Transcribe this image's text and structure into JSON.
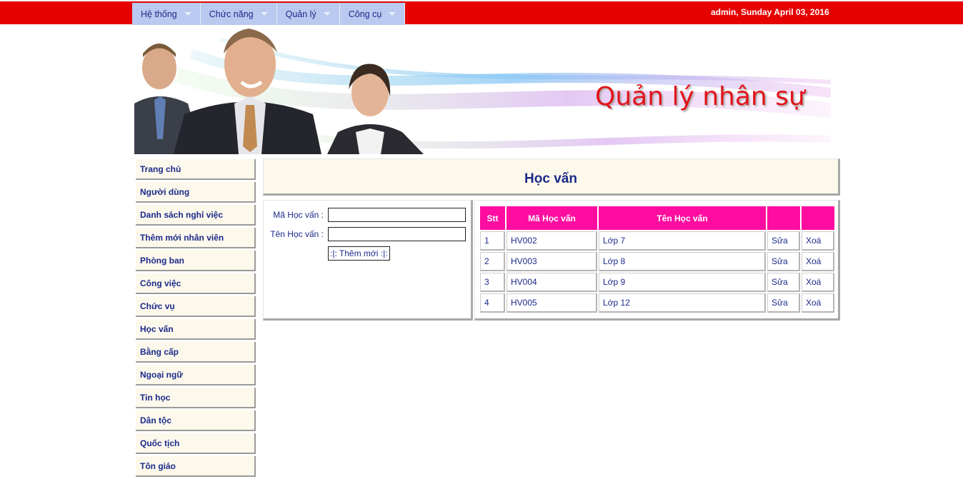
{
  "menu": [
    {
      "label": "Hệ thống"
    },
    {
      "label": "Chức năng"
    },
    {
      "label": "Quản lý"
    },
    {
      "label": "Công cụ"
    }
  ],
  "user_info": "admin, Sunday April 03, 2016",
  "banner": {
    "title": "Quản lý nhân sự"
  },
  "sidebar": [
    "Trang chủ",
    "Người dùng",
    "Danh sách nghỉ việc",
    "Thêm mới nhân viên",
    "Phòng ban",
    "Công việc",
    "Chức vụ",
    "Học vấn",
    "Bằng cấp",
    "Ngoại ngữ",
    "Tin học",
    "Dân tộc",
    "Quốc tịch",
    "Tôn giáo"
  ],
  "page_title": "Học vấn",
  "form": {
    "ma_label": "Mã Học vấn :",
    "ma_value": "",
    "ten_label": "Tên Học vấn :",
    "ten_value": "",
    "add_button": ":|: Thêm mới :|:"
  },
  "table": {
    "headers": [
      "Stt",
      "Mã Học vấn",
      "Tên Học vấn",
      "",
      ""
    ],
    "rows": [
      {
        "stt": "1",
        "ma": "HV002",
        "ten": "Lớp 7",
        "edit": "Sửa",
        "del": "Xoá"
      },
      {
        "stt": "2",
        "ma": "HV003",
        "ten": "Lớp 8",
        "edit": "Sửa",
        "del": "Xoá"
      },
      {
        "stt": "3",
        "ma": "HV004",
        "ten": "Lớp 9",
        "edit": "Sửa",
        "del": "Xoá"
      },
      {
        "stt": "4",
        "ma": "HV005",
        "ten": "Lớp 12",
        "edit": "Sửa",
        "del": "Xoá"
      }
    ]
  },
  "colors": {
    "topbar": "#e60000",
    "menu_bg": "#b9c9ef",
    "header_pink": "#ff0da0",
    "text_blue": "#1b2a8a",
    "panel_bg": "#fdf8ec"
  }
}
